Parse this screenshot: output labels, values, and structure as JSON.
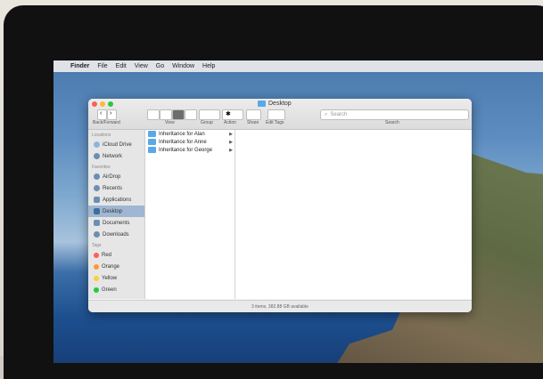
{
  "menubar": {
    "apple": "",
    "items": [
      "Finder",
      "File",
      "Edit",
      "View",
      "Go",
      "Window",
      "Help"
    ]
  },
  "window": {
    "title": "Desktop",
    "toolbar": {
      "back_forward_label": "Back/Forward",
      "view_label": "View",
      "group_label": "Group",
      "action_label": "Action",
      "share_label": "Share",
      "edit_tags_label": "Edit Tags",
      "search_label": "Search",
      "search_placeholder": "Search"
    },
    "sidebar": {
      "locations_header": "Locations",
      "locations": [
        "iCloud Drive",
        "Network"
      ],
      "favorites_header": "Favorites",
      "favorites": [
        "AirDrop",
        "Recents",
        "Applications",
        "Desktop",
        "Documents",
        "Downloads"
      ],
      "selected": "Desktop",
      "tags_header": "Tags",
      "tags": [
        {
          "label": "Red",
          "color": "#fb5f57"
        },
        {
          "label": "Orange",
          "color": "#fd9a2e"
        },
        {
          "label": "Yellow",
          "color": "#fdd02e"
        },
        {
          "label": "Green",
          "color": "#28c840"
        }
      ]
    },
    "files": [
      "Inheritance for Alan",
      "Inheritance for Anne",
      "Inheritance for George"
    ],
    "status": "3 items, 382.88 GB available"
  }
}
